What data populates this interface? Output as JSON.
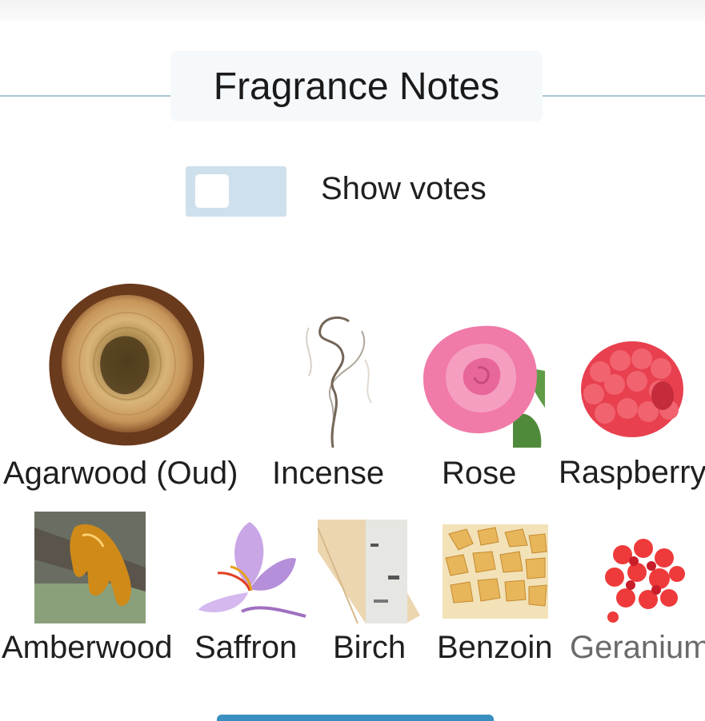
{
  "section": {
    "title": "Fragrance Notes"
  },
  "toggle": {
    "label": "Show votes",
    "checked": false,
    "track_color": "#cfe0ed"
  },
  "notes": [
    {
      "name": "Agarwood (Oud)",
      "icon": "agarwood-image"
    },
    {
      "name": "Incense",
      "icon": "incense-smoke-image"
    },
    {
      "name": "Rose",
      "icon": "rose-image"
    },
    {
      "name": "Raspberry",
      "icon": "raspberry-image"
    },
    {
      "name": "Amberwood",
      "icon": "amberwood-resin-image"
    },
    {
      "name": "Saffron",
      "icon": "saffron-flower-image"
    },
    {
      "name": "Birch",
      "icon": "birch-branch-image"
    },
    {
      "name": "Benzoin",
      "icon": "benzoin-resin-image"
    },
    {
      "name": "Geranium",
      "icon": "geranium-flower-image"
    }
  ],
  "colors": {
    "accent": "#3a8fc1",
    "rule": "#a9c4d6",
    "title_bg": "#f5f9fc"
  }
}
